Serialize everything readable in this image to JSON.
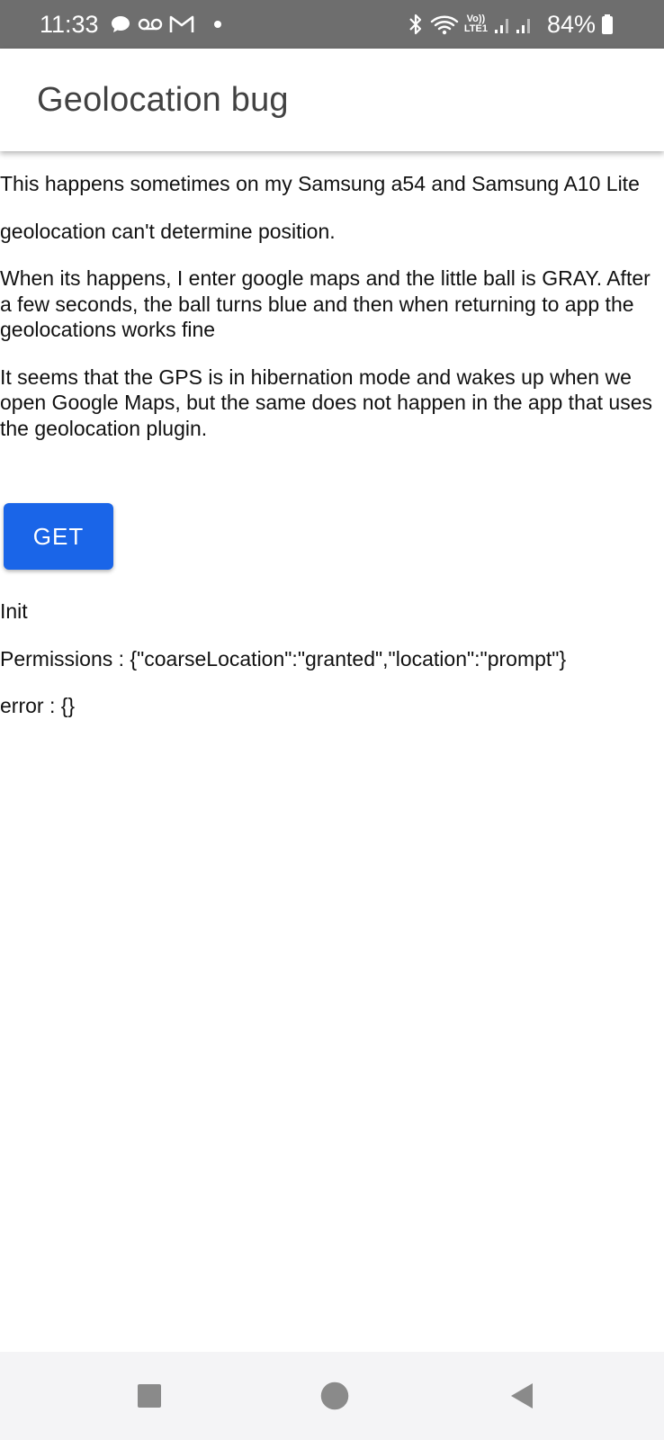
{
  "status_bar": {
    "time": "11:33",
    "battery_percent": "84%",
    "network_label_top": "Vo))",
    "network_label_bottom": "LTE1",
    "icons": [
      "chat-icon",
      "voicemail-icon",
      "gmail-icon",
      "dot-icon",
      "bluetooth-icon",
      "wifi-icon",
      "signal-icon",
      "battery-icon"
    ]
  },
  "header": {
    "title": "Geolocation bug"
  },
  "content": {
    "paragraphs": [
      "This happens sometimes on my Samsung a54 and Samsung A10 Lite",
      "geolocation can't determine position.",
      "When its happens, I enter google maps and the little ball is GRAY. After a few seconds, the ball turns blue and then when returning to app the geolocations works fine",
      "It seems that the GPS is in hibernation mode and wakes up when we open Google Maps, but the same does not happen in the app that uses the geolocation plugin."
    ]
  },
  "get_button": {
    "label": "GET",
    "color": "#1a65e8"
  },
  "log": {
    "lines": [
      "Init",
      "Permissions : {\"coarseLocation\":\"granted\",\"location\":\"prompt\"}",
      "error : {}"
    ]
  },
  "nav_bar": {
    "icons": [
      "recents-icon",
      "home-icon",
      "back-icon"
    ]
  }
}
